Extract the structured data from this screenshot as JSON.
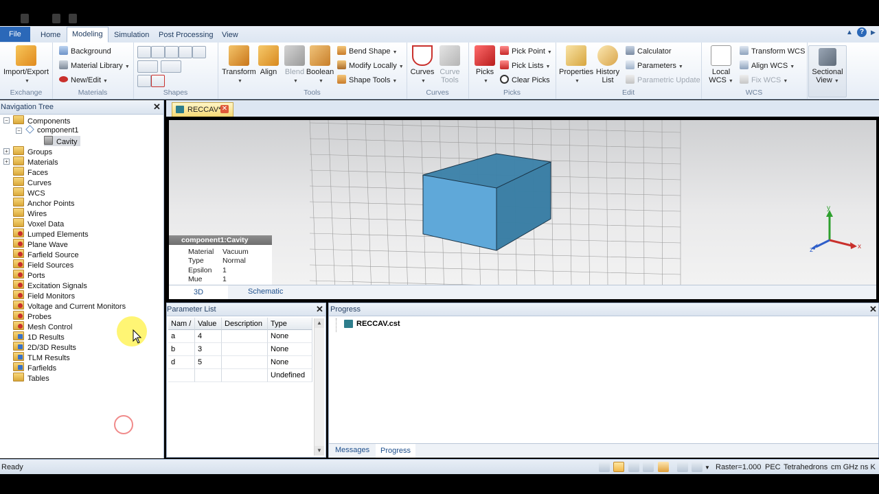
{
  "ribbon_tabs": [
    "File",
    "Home",
    "Modeling",
    "Simulation",
    "Post Processing",
    "View"
  ],
  "ribbon": {
    "exchange": {
      "label": "Exchange",
      "import_export": "Import/Export"
    },
    "materials": {
      "label": "Materials",
      "background": "Background",
      "material_library": "Material Library",
      "new_edit": "New/Edit"
    },
    "shapes": {
      "label": "Shapes"
    },
    "tools": {
      "label": "Tools",
      "transform": "Transform",
      "align": "Align",
      "blend": "Blend",
      "boolean": "Boolean",
      "bend_shape": "Bend Shape",
      "modify_locally": "Modify Locally",
      "shape_tools": "Shape Tools"
    },
    "curves": {
      "label": "Curves",
      "curves": "Curves",
      "curve_tools_1": "Curve",
      "curve_tools_2": "Tools"
    },
    "picks": {
      "label": "Picks",
      "picks": "Picks",
      "pick_point": "Pick Point",
      "pick_lists": "Pick Lists",
      "clear_picks": "Clear Picks"
    },
    "edit": {
      "label": "Edit",
      "properties": "Properties",
      "history_1": "History",
      "history_2": "List",
      "calculator": "Calculator",
      "parameters": "Parameters",
      "parametric_update": "Parametric Update"
    },
    "wcs": {
      "label": "WCS",
      "local_1": "Local",
      "local_2": "WCS",
      "transform_wcs": "Transform WCS",
      "align_wcs": "Align WCS",
      "fix_wcs": "Fix WCS"
    },
    "sectional_1": "Sectional",
    "sectional_2": "View"
  },
  "nav": {
    "title": "Navigation Tree",
    "components": "Components",
    "component1": "component1",
    "cavity": "Cavity",
    "items": [
      "Groups",
      "Materials",
      "Faces",
      "Curves",
      "WCS",
      "Anchor Points",
      "Wires",
      "Voxel Data",
      "Lumped Elements",
      "Plane Wave",
      "Farfield Source",
      "Field Sources",
      "Ports",
      "Excitation Signals",
      "Field Monitors",
      "Voltage and Current Monitors",
      "Probes",
      "Mesh Control",
      "1D Results",
      "2D/3D Results",
      "TLM Results",
      "Farfields",
      "Tables"
    ]
  },
  "document_tab": "RECCAV*",
  "info": {
    "title": "component1:Cavity",
    "rows": [
      {
        "k": "Material",
        "v": "Vacuum"
      },
      {
        "k": "Type",
        "v": "Normal"
      },
      {
        "k": "Epsilon",
        "v": "1"
      },
      {
        "k": "Mue",
        "v": "1"
      }
    ]
  },
  "axes": {
    "x": "x",
    "y": "y",
    "z": "z"
  },
  "view_tabs": [
    "3D",
    "Schematic"
  ],
  "params": {
    "title": "Parameter List",
    "headers": [
      "Nam /",
      "Value",
      "Description",
      "Type"
    ],
    "rows": [
      {
        "name": "a",
        "value": "4",
        "desc": "",
        "type": "None"
      },
      {
        "name": "b",
        "value": "3",
        "desc": "",
        "type": "None"
      },
      {
        "name": "d",
        "value": "5",
        "desc": "",
        "type": "None"
      },
      {
        "name": "",
        "value": "",
        "desc": "",
        "type": "Undefined"
      }
    ]
  },
  "progress": {
    "title": "Progress",
    "file": "RECCAV.cst",
    "tabs": [
      "Messages",
      "Progress"
    ]
  },
  "status": {
    "ready": "Ready",
    "raster": "Raster=1.000",
    "pec": "PEC",
    "mesh": "Tetrahedrons",
    "units": "cm  GHz  ns  K"
  }
}
